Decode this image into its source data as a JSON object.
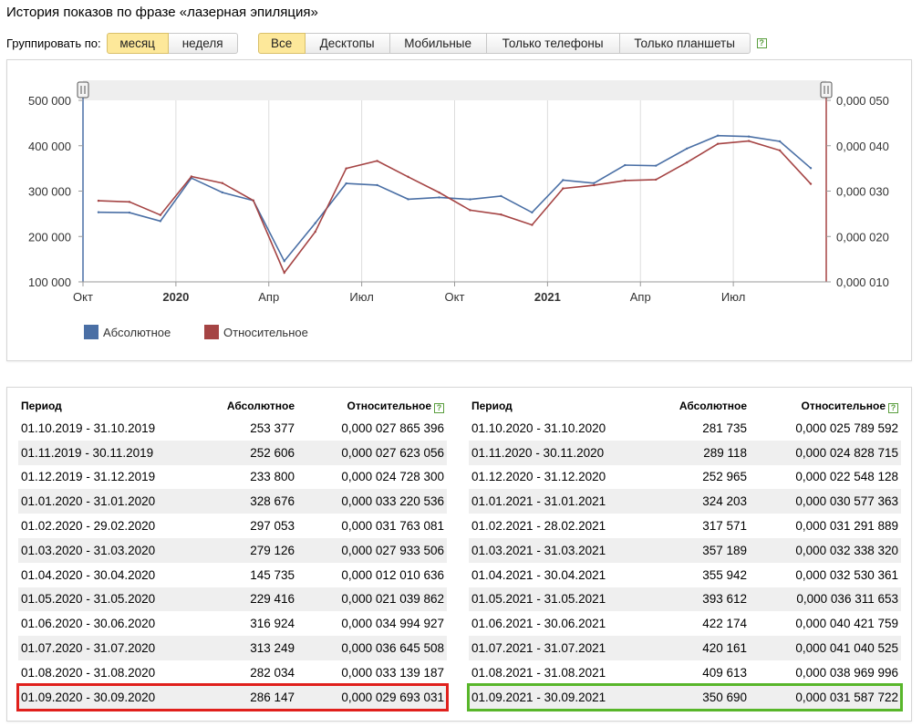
{
  "page": {
    "title": "История показов по фразе «лазерная эпиляция»"
  },
  "grouping": {
    "label": "Группировать по:",
    "options": [
      "месяц",
      "неделя"
    ],
    "selected": "месяц"
  },
  "devices": {
    "options": [
      "Все",
      "Десктопы",
      "Мобильные",
      "Только телефоны",
      "Только планшеты"
    ],
    "selected": "Все",
    "help_icon": "?"
  },
  "colors": {
    "absolute": "#4a6fa5",
    "relative": "#a54444",
    "active_button": "#fde89a",
    "highlight_red": "#e0201c",
    "highlight_green": "#58b62a"
  },
  "chart_data": {
    "type": "line",
    "x": [
      "2019-10",
      "2019-11",
      "2019-12",
      "2020-01",
      "2020-02",
      "2020-03",
      "2020-04",
      "2020-05",
      "2020-06",
      "2020-07",
      "2020-08",
      "2020-09",
      "2020-10",
      "2020-11",
      "2020-12",
      "2021-01",
      "2021-02",
      "2021-03",
      "2021-04",
      "2021-05",
      "2021-06",
      "2021-07",
      "2021-08",
      "2021-09"
    ],
    "x_tick_labels": [
      "Окт",
      "2020",
      "Апр",
      "Июл",
      "Окт",
      "2021",
      "Апр",
      "Июл"
    ],
    "x_tick_months": [
      "2019-10",
      "2020-01",
      "2020-04",
      "2020-07",
      "2020-10",
      "2021-01",
      "2021-04",
      "2021-07"
    ],
    "series": [
      {
        "name": "Абсолютное",
        "axis": "left",
        "values": [
          253377,
          252606,
          233800,
          328676,
          297053,
          279126,
          145735,
          229416,
          316924,
          313249,
          282034,
          286147,
          281735,
          289118,
          252965,
          324203,
          317571,
          357189,
          355942,
          393612,
          422174,
          420161,
          409613,
          350690
        ]
      },
      {
        "name": "Относительное",
        "axis": "right",
        "values": [
          2.7865396e-05,
          2.7623056e-05,
          2.47283e-05,
          3.3220536e-05,
          3.1763081e-05,
          2.7933506e-05,
          1.2010636e-05,
          2.1039862e-05,
          3.4994927e-05,
          3.6645508e-05,
          3.3139187e-05,
          2.9693031e-05,
          2.5789592e-05,
          2.4828715e-05,
          2.2548128e-05,
          3.0577363e-05,
          3.1291889e-05,
          3.233832e-05,
          3.2530361e-05,
          3.6311653e-05,
          4.0421759e-05,
          4.1040525e-05,
          3.8969996e-05,
          3.1587722e-05
        ]
      }
    ],
    "y_left": {
      "ylim": [
        100000,
        500000
      ],
      "tick_labels": [
        "100 000",
        "200 000",
        "300 000",
        "400 000",
        "500 000"
      ]
    },
    "y_right": {
      "ylim": [
        1e-05,
        5e-05
      ],
      "tick_labels": [
        "0,000 010",
        "0,000 020",
        "0,000 030",
        "0,000 040",
        "0,000 050"
      ]
    },
    "grid": "vertical",
    "legend_position": "bottom-left",
    "legend": [
      "Абсолютное",
      "Относительное"
    ],
    "range_handle_icon": "drag-handle-icon"
  },
  "table": {
    "headers": {
      "period": "Период",
      "absolute": "Абсолютное",
      "relative": "Относительное"
    },
    "left": [
      {
        "period": "01.10.2019 - 31.10.2019",
        "absolute": "253 377",
        "relative": "0,000 027 865 396"
      },
      {
        "period": "01.11.2019 - 30.11.2019",
        "absolute": "252 606",
        "relative": "0,000 027 623 056"
      },
      {
        "period": "01.12.2019 - 31.12.2019",
        "absolute": "233 800",
        "relative": "0,000 024 728 300"
      },
      {
        "period": "01.01.2020 - 31.01.2020",
        "absolute": "328 676",
        "relative": "0,000 033 220 536"
      },
      {
        "period": "01.02.2020 - 29.02.2020",
        "absolute": "297 053",
        "relative": "0,000 031 763 081"
      },
      {
        "period": "01.03.2020 - 31.03.2020",
        "absolute": "279 126",
        "relative": "0,000 027 933 506"
      },
      {
        "period": "01.04.2020 - 30.04.2020",
        "absolute": "145 735",
        "relative": "0,000 012 010 636"
      },
      {
        "period": "01.05.2020 - 31.05.2020",
        "absolute": "229 416",
        "relative": "0,000 021 039 862"
      },
      {
        "period": "01.06.2020 - 30.06.2020",
        "absolute": "316 924",
        "relative": "0,000 034 994 927"
      },
      {
        "period": "01.07.2020 - 31.07.2020",
        "absolute": "313 249",
        "relative": "0,000 036 645 508"
      },
      {
        "period": "01.08.2020 - 31.08.2020",
        "absolute": "282 034",
        "relative": "0,000 033 139 187"
      },
      {
        "period": "01.09.2020 - 30.09.2020",
        "absolute": "286 147",
        "relative": "0,000 029 693 031",
        "highlight": "red"
      }
    ],
    "right": [
      {
        "period": "01.10.2020 - 31.10.2020",
        "absolute": "281 735",
        "relative": "0,000 025 789 592"
      },
      {
        "period": "01.11.2020 - 30.11.2020",
        "absolute": "289 118",
        "relative": "0,000 024 828 715"
      },
      {
        "period": "01.12.2020 - 31.12.2020",
        "absolute": "252 965",
        "relative": "0,000 022 548 128"
      },
      {
        "period": "01.01.2021 - 31.01.2021",
        "absolute": "324 203",
        "relative": "0,000 030 577 363"
      },
      {
        "period": "01.02.2021 - 28.02.2021",
        "absolute": "317 571",
        "relative": "0,000 031 291 889"
      },
      {
        "period": "01.03.2021 - 31.03.2021",
        "absolute": "357 189",
        "relative": "0,000 032 338 320"
      },
      {
        "period": "01.04.2021 - 30.04.2021",
        "absolute": "355 942",
        "relative": "0,000 032 530 361"
      },
      {
        "period": "01.05.2021 - 31.05.2021",
        "absolute": "393 612",
        "relative": "0,000 036 311 653"
      },
      {
        "period": "01.06.2021 - 30.06.2021",
        "absolute": "422 174",
        "relative": "0,000 040 421 759"
      },
      {
        "period": "01.07.2021 - 31.07.2021",
        "absolute": "420 161",
        "relative": "0,000 041 040 525"
      },
      {
        "period": "01.08.2021 - 31.08.2021",
        "absolute": "409 613",
        "relative": "0,000 038 969 996"
      },
      {
        "period": "01.09.2021 - 30.09.2021",
        "absolute": "350 690",
        "relative": "0,000 031 587 722",
        "highlight": "green"
      }
    ]
  }
}
